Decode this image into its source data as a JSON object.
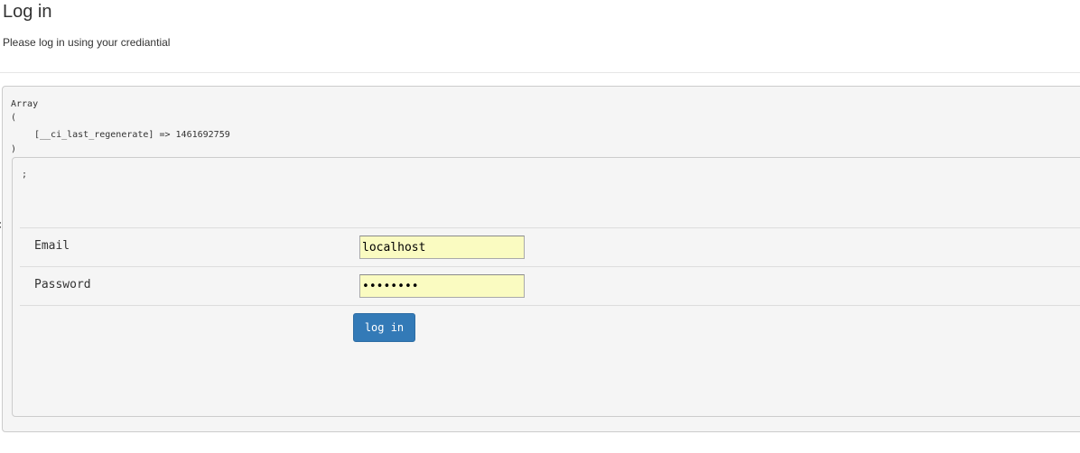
{
  "header": {
    "title": "Log in",
    "subtitle": "Please log in using your crediantial"
  },
  "debug_dump": {
    "line1": "Array",
    "line2": "(",
    "line3": "[__ci_last_regenerate] => 1461692759",
    "line4": ")",
    "inner": ";"
  },
  "nav": {
    "chevron": "‹"
  },
  "form": {
    "email_label": "Email",
    "email_value": "localhost",
    "password_label": "Password",
    "password_value": "password",
    "submit_label": "log in"
  },
  "colors": {
    "button_bg": "#337ab7",
    "input_autofill_bg": "#fafbc1",
    "panel_bg": "#f5f5f5"
  }
}
